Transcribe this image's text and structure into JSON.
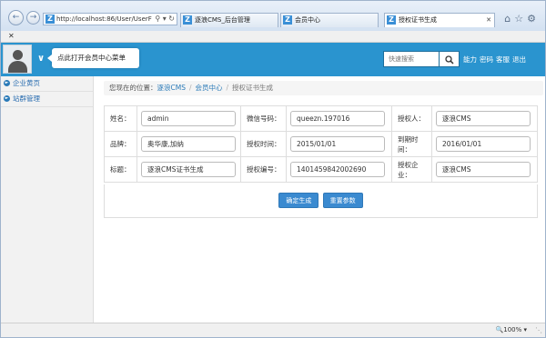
{
  "browser": {
    "address": "http://localhost:86/User/UserF",
    "tabs": [
      {
        "label": "逐浪CMS_后台管理"
      },
      {
        "label": "会员中心"
      },
      {
        "label": "授权证书生成"
      }
    ],
    "zoom": "100%"
  },
  "header": {
    "tooltip": "点此打开会员中心菜单",
    "search_placeholder": "快速搜索",
    "links": [
      "能力",
      "密码",
      "客服",
      "退出"
    ]
  },
  "sidebar": {
    "items": [
      {
        "label": "企业黄页"
      },
      {
        "label": "站群管理"
      }
    ]
  },
  "breadcrumb": {
    "prefix": "您现在的位置：",
    "crumbs": [
      "逐浪CMS",
      "会员中心"
    ],
    "current": "授权证书生成"
  },
  "form": {
    "rows": [
      [
        {
          "label": "姓名：",
          "value": "admin"
        },
        {
          "label": "微信号码：",
          "value": "queezn.197016"
        },
        {
          "label": "授权人：",
          "value": "逐浪CMS"
        }
      ],
      [
        {
          "label": "品牌：",
          "value": "奥华康,加纳"
        },
        {
          "label": "授权时间：",
          "value": "2015/01/01"
        },
        {
          "label": "到期时间：",
          "value": "2016/01/01"
        }
      ],
      [
        {
          "label": "标题：",
          "value": "逐浪CMS证书生成"
        },
        {
          "label": "授权编号：",
          "value": "1401459842002690"
        },
        {
          "label": "授权企业：",
          "value": "逐浪CMS"
        }
      ]
    ],
    "submit_label": "确定生成",
    "reset_label": "重置参数"
  }
}
